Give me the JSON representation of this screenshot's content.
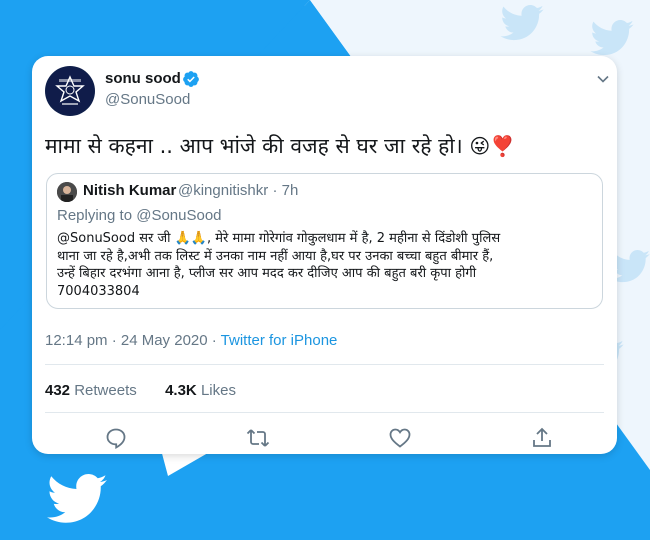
{
  "tweet": {
    "author": {
      "name": "sonu sood",
      "handle": "@SonuSood",
      "verified": true,
      "avatar": "maharashtra-police-logo"
    },
    "text": "मामा से कहना .. आप भांजे की वजह से घर जा रहे हो।",
    "emojis": "😜❣️",
    "quoted": {
      "name": "Nitish Kumar",
      "handle": "@kingnitishkr",
      "time": "· 7h",
      "replying_prefix": "Replying to",
      "replying_to": "@SonuSood",
      "lines": [
        "@SonuSood सर जी 🙏🙏, मेरे मामा गोरेगांव गोकुलधाम में है, 2 महीना से दिंडोशी पुलिस",
        "थाना जा रहे है,अभी तक लिस्ट में उनका नाम नहीं आया है,घर पर उनका बच्चा बहुत बीमार हैं,",
        "उन्हें बिहार दरभंगा आना है, प्लीज सर आप मदद कर दीजिए आप की बहुत बरी कृपा होगी",
        "7004033804"
      ]
    },
    "timestamp": "12:14 pm · 24 May 2020",
    "source_sep": " · ",
    "source": "Twitter for iPhone",
    "retweets": {
      "count": "432",
      "label": "Retweets"
    },
    "likes": {
      "count": "4.3K",
      "label": "Likes"
    }
  },
  "icons": {
    "reply": "reply-icon",
    "retweet": "retweet-icon",
    "like": "heart-icon",
    "share": "share-icon",
    "caret": "chevron-down-icon",
    "verified": "verified-badge-icon",
    "brand": "twitter-bird-icon"
  },
  "colors": {
    "background": "#1da1f2",
    "link": "#1b95e0",
    "muted": "#657786",
    "verified": "#1da1f2"
  }
}
